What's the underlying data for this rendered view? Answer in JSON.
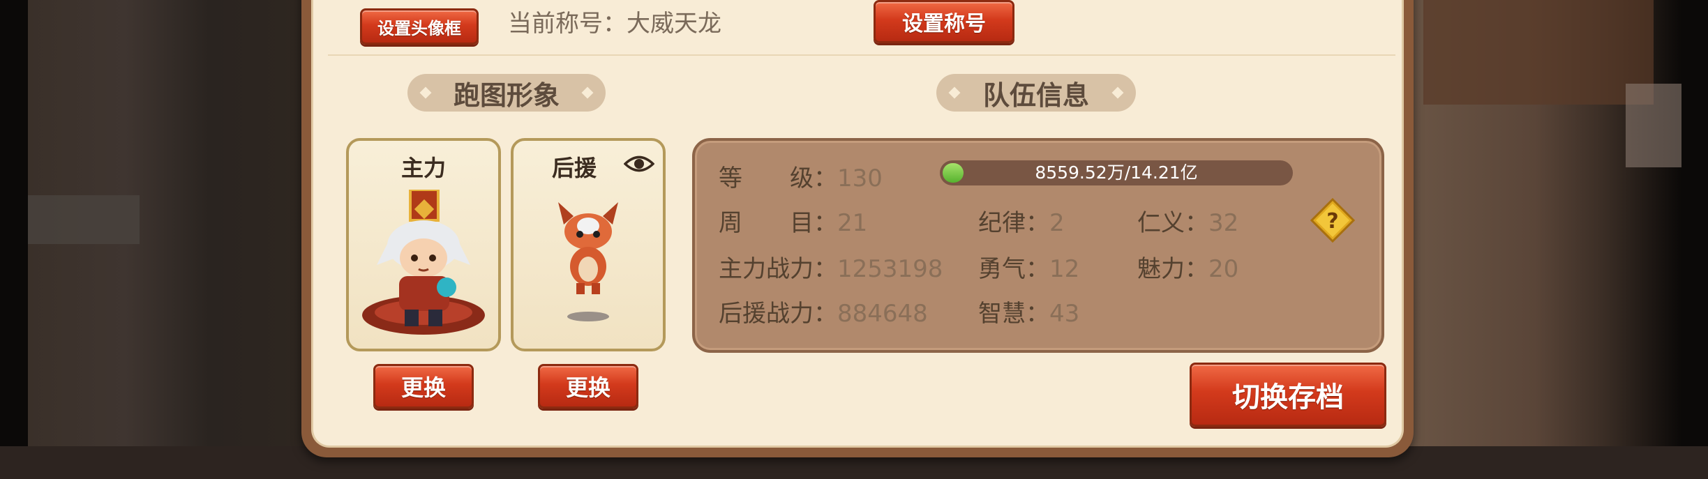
{
  "header": {
    "frame_button": "设置头像框",
    "current_title_label": "当前称号：",
    "current_title_value": "大威天龙",
    "set_title_button": "设置称号"
  },
  "sections": {
    "run_image": "跑图形象",
    "team_info": "队伍信息"
  },
  "cards": {
    "main_label": "主力",
    "support_label": "后援",
    "swap_main": "更换",
    "swap_support": "更换"
  },
  "team": {
    "level_key": "等　　级：",
    "level": "130",
    "exp_text": "8559.52万/14.21亿",
    "exp_progress": 0.06,
    "cycle_key": "周　　目：",
    "cycle": "21",
    "discipline_key": "纪律：",
    "discipline": "2",
    "benevolence_key": "仁义：",
    "benevolence": "32",
    "main_power_key": "主力战力：",
    "main_power": "1253198",
    "courage_key": "勇气：",
    "courage": "12",
    "charm_key": "魅力：",
    "charm": "20",
    "support_power_key": "后援战力：",
    "support_power": "884648",
    "wisdom_key": "智慧：",
    "wisdom": "43"
  },
  "actions": {
    "switch_save": "切换存档"
  },
  "icons": {
    "help": "question-icon",
    "eye": "eye-icon"
  },
  "colors": {
    "panel": "#f8ecd6",
    "button_red": "#d33a1c",
    "exp_green": "#56b22e"
  }
}
